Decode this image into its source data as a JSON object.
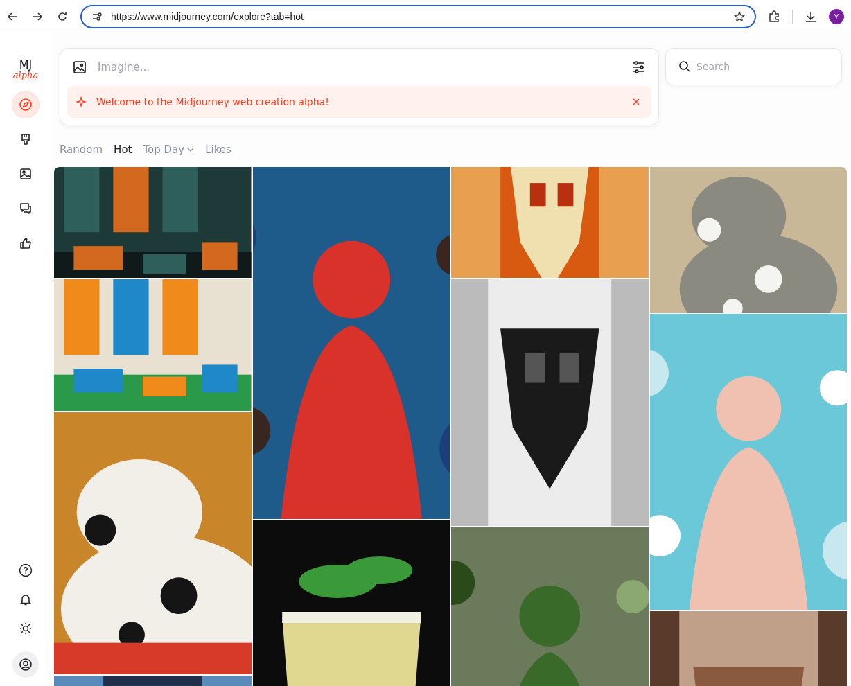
{
  "browser": {
    "url": "https://www.midjourney.com/explore?tab=hot",
    "profile_initial": "Y"
  },
  "sidebar": {
    "logo": "MJ",
    "logo_sub": "alpha",
    "nav": [
      {
        "selected": true
      },
      {
        "selected": false
      },
      {
        "selected": false
      },
      {
        "selected": false
      },
      {
        "selected": false
      }
    ]
  },
  "prompt": {
    "placeholder": "Imagine...",
    "banner": "Welcome to the Midjourney web creation alpha!"
  },
  "search": {
    "placeholder": "Search"
  },
  "tabs": [
    {
      "label": "Random",
      "selected": false,
      "dropdown": false
    },
    {
      "label": "Hot",
      "selected": true,
      "dropdown": false
    },
    {
      "label": "Top Day",
      "selected": false,
      "dropdown": true
    },
    {
      "label": "Likes",
      "selected": false,
      "dropdown": false
    }
  ]
}
